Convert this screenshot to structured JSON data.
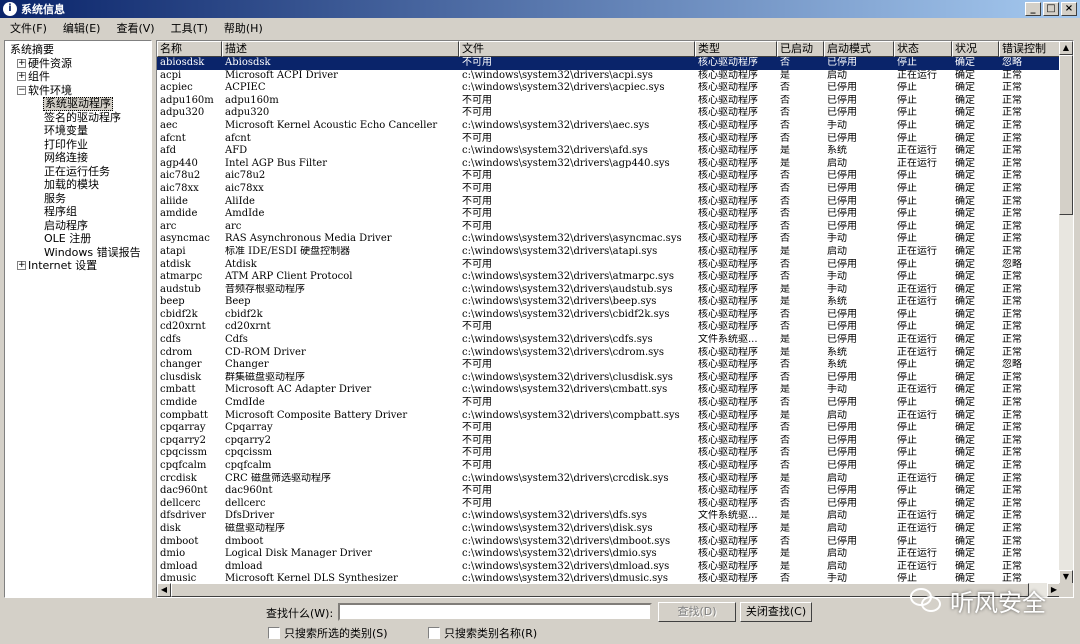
{
  "window": {
    "title": "系统信息",
    "controls": [
      "_",
      "□",
      "×"
    ]
  },
  "menu": [
    "文件(F)",
    "编辑(E)",
    "查看(V)",
    "工具(T)",
    "帮助(H)"
  ],
  "tree": [
    {
      "label": "系统摘要",
      "level": 0,
      "expander": ""
    },
    {
      "label": "硬件资源",
      "level": 1,
      "expander": "+"
    },
    {
      "label": "组件",
      "level": 1,
      "expander": "+"
    },
    {
      "label": "软件环境",
      "level": 1,
      "expander": "−"
    },
    {
      "label": "系统驱动程序",
      "level": 2,
      "expander": "",
      "selected": true
    },
    {
      "label": "签名的驱动程序",
      "level": 2,
      "expander": ""
    },
    {
      "label": "环境变量",
      "level": 2,
      "expander": ""
    },
    {
      "label": "打印作业",
      "level": 2,
      "expander": ""
    },
    {
      "label": "网络连接",
      "level": 2,
      "expander": ""
    },
    {
      "label": "正在运行任务",
      "level": 2,
      "expander": ""
    },
    {
      "label": "加载的模块",
      "level": 2,
      "expander": ""
    },
    {
      "label": "服务",
      "level": 2,
      "expander": ""
    },
    {
      "label": "程序组",
      "level": 2,
      "expander": ""
    },
    {
      "label": "启动程序",
      "level": 2,
      "expander": ""
    },
    {
      "label": "OLE 注册",
      "level": 2,
      "expander": ""
    },
    {
      "label": "Windows 错误报告",
      "level": 2,
      "expander": ""
    },
    {
      "label": "Internet 设置",
      "level": 1,
      "expander": "+"
    }
  ],
  "table": {
    "columns": [
      "名称",
      "描述",
      "文件",
      "类型",
      "已启动",
      "启动模式",
      "状态",
      "状况",
      "错误控制"
    ],
    "rows": [
      [
        "abiosdsk",
        "Abiosdsk",
        "不可用",
        "核心驱动程序",
        "否",
        "已停用",
        "停止",
        "确定",
        "忽略"
      ],
      [
        "acpi",
        "Microsoft ACPI Driver",
        "c:\\windows\\system32\\drivers\\acpi.sys",
        "核心驱动程序",
        "是",
        "启动",
        "正在运行",
        "确定",
        "正常"
      ],
      [
        "acpiec",
        "ACPIEC",
        "c:\\windows\\system32\\drivers\\acpiec.sys",
        "核心驱动程序",
        "否",
        "已停用",
        "停止",
        "确定",
        "正常"
      ],
      [
        "adpu160m",
        "adpu160m",
        "不可用",
        "核心驱动程序",
        "否",
        "已停用",
        "停止",
        "确定",
        "正常"
      ],
      [
        "adpu320",
        "adpu320",
        "不可用",
        "核心驱动程序",
        "否",
        "已停用",
        "停止",
        "确定",
        "正常"
      ],
      [
        "aec",
        "Microsoft Kernel Acoustic Echo Canceller",
        "c:\\windows\\system32\\drivers\\aec.sys",
        "核心驱动程序",
        "否",
        "手动",
        "停止",
        "确定",
        "正常"
      ],
      [
        "afcnt",
        "afcnt",
        "不可用",
        "核心驱动程序",
        "否",
        "已停用",
        "停止",
        "确定",
        "正常"
      ],
      [
        "afd",
        "AFD",
        "c:\\windows\\system32\\drivers\\afd.sys",
        "核心驱动程序",
        "是",
        "系统",
        "正在运行",
        "确定",
        "正常"
      ],
      [
        "agp440",
        "Intel AGP Bus Filter",
        "c:\\windows\\system32\\drivers\\agp440.sys",
        "核心驱动程序",
        "是",
        "启动",
        "正在运行",
        "确定",
        "正常"
      ],
      [
        "aic78u2",
        "aic78u2",
        "不可用",
        "核心驱动程序",
        "否",
        "已停用",
        "停止",
        "确定",
        "正常"
      ],
      [
        "aic78xx",
        "aic78xx",
        "不可用",
        "核心驱动程序",
        "否",
        "已停用",
        "停止",
        "确定",
        "正常"
      ],
      [
        "aliide",
        "AliIde",
        "不可用",
        "核心驱动程序",
        "否",
        "已停用",
        "停止",
        "确定",
        "正常"
      ],
      [
        "amdide",
        "AmdIde",
        "不可用",
        "核心驱动程序",
        "否",
        "已停用",
        "停止",
        "确定",
        "正常"
      ],
      [
        "arc",
        "arc",
        "不可用",
        "核心驱动程序",
        "否",
        "已停用",
        "停止",
        "确定",
        "正常"
      ],
      [
        "asyncmac",
        "RAS Asynchronous Media Driver",
        "c:\\windows\\system32\\drivers\\asyncmac.sys",
        "核心驱动程序",
        "否",
        "手动",
        "停止",
        "确定",
        "正常"
      ],
      [
        "atapi",
        "标准 IDE/ESDI 硬盘控制器",
        "c:\\windows\\system32\\drivers\\atapi.sys",
        "核心驱动程序",
        "是",
        "启动",
        "正在运行",
        "确定",
        "正常"
      ],
      [
        "atdisk",
        "Atdisk",
        "不可用",
        "核心驱动程序",
        "否",
        "已停用",
        "停止",
        "确定",
        "忽略"
      ],
      [
        "atmarpc",
        "ATM ARP Client Protocol",
        "c:\\windows\\system32\\drivers\\atmarpc.sys",
        "核心驱动程序",
        "否",
        "手动",
        "停止",
        "确定",
        "正常"
      ],
      [
        "audstub",
        "音频存根驱动程序",
        "c:\\windows\\system32\\drivers\\audstub.sys",
        "核心驱动程序",
        "是",
        "手动",
        "正在运行",
        "确定",
        "正常"
      ],
      [
        "beep",
        "Beep",
        "c:\\windows\\system32\\drivers\\beep.sys",
        "核心驱动程序",
        "是",
        "系统",
        "正在运行",
        "确定",
        "正常"
      ],
      [
        "cbidf2k",
        "cbidf2k",
        "c:\\windows\\system32\\drivers\\cbidf2k.sys",
        "核心驱动程序",
        "否",
        "已停用",
        "停止",
        "确定",
        "正常"
      ],
      [
        "cd20xrnt",
        "cd20xrnt",
        "不可用",
        "核心驱动程序",
        "否",
        "已停用",
        "停止",
        "确定",
        "正常"
      ],
      [
        "cdfs",
        "Cdfs",
        "c:\\windows\\system32\\drivers\\cdfs.sys",
        "文件系统驱...",
        "是",
        "已停用",
        "正在运行",
        "确定",
        "正常"
      ],
      [
        "cdrom",
        "CD-ROM Driver",
        "c:\\windows\\system32\\drivers\\cdrom.sys",
        "核心驱动程序",
        "是",
        "系统",
        "正在运行",
        "确定",
        "正常"
      ],
      [
        "changer",
        "Changer",
        "不可用",
        "核心驱动程序",
        "否",
        "系统",
        "停止",
        "确定",
        "忽略"
      ],
      [
        "clusdisk",
        "群集磁盘驱动程序",
        "c:\\windows\\system32\\drivers\\clusdisk.sys",
        "核心驱动程序",
        "否",
        "已停用",
        "停止",
        "确定",
        "正常"
      ],
      [
        "cmbatt",
        "Microsoft AC Adapter Driver",
        "c:\\windows\\system32\\drivers\\cmbatt.sys",
        "核心驱动程序",
        "是",
        "手动",
        "正在运行",
        "确定",
        "正常"
      ],
      [
        "cmdide",
        "CmdIde",
        "不可用",
        "核心驱动程序",
        "否",
        "已停用",
        "停止",
        "确定",
        "正常"
      ],
      [
        "compbatt",
        "Microsoft Composite Battery Driver",
        "c:\\windows\\system32\\drivers\\compbatt.sys",
        "核心驱动程序",
        "是",
        "启动",
        "正在运行",
        "确定",
        "正常"
      ],
      [
        "cpqarray",
        "Cpqarray",
        "不可用",
        "核心驱动程序",
        "否",
        "已停用",
        "停止",
        "确定",
        "正常"
      ],
      [
        "cpqarry2",
        "cpqarry2",
        "不可用",
        "核心驱动程序",
        "否",
        "已停用",
        "停止",
        "确定",
        "正常"
      ],
      [
        "cpqcissm",
        "cpqcissm",
        "不可用",
        "核心驱动程序",
        "否",
        "已停用",
        "停止",
        "确定",
        "正常"
      ],
      [
        "cpqfcalm",
        "cpqfcalm",
        "不可用",
        "核心驱动程序",
        "否",
        "已停用",
        "停止",
        "确定",
        "正常"
      ],
      [
        "crcdisk",
        "CRC 磁盘筛选驱动程序",
        "c:\\windows\\system32\\drivers\\crcdisk.sys",
        "核心驱动程序",
        "是",
        "启动",
        "正在运行",
        "确定",
        "正常"
      ],
      [
        "dac960nt",
        "dac960nt",
        "不可用",
        "核心驱动程序",
        "否",
        "已停用",
        "停止",
        "确定",
        "正常"
      ],
      [
        "dellcerc",
        "dellcerc",
        "不可用",
        "核心驱动程序",
        "否",
        "已停用",
        "停止",
        "确定",
        "正常"
      ],
      [
        "dfsdriver",
        "DfsDriver",
        "c:\\windows\\system32\\drivers\\dfs.sys",
        "文件系统驱...",
        "是",
        "启动",
        "正在运行",
        "确定",
        "正常"
      ],
      [
        "disk",
        "磁盘驱动程序",
        "c:\\windows\\system32\\drivers\\disk.sys",
        "核心驱动程序",
        "是",
        "启动",
        "正在运行",
        "确定",
        "正常"
      ],
      [
        "dmboot",
        "dmboot",
        "c:\\windows\\system32\\drivers\\dmboot.sys",
        "核心驱动程序",
        "否",
        "已停用",
        "停止",
        "确定",
        "正常"
      ],
      [
        "dmio",
        "Logical Disk Manager Driver",
        "c:\\windows\\system32\\drivers\\dmio.sys",
        "核心驱动程序",
        "是",
        "启动",
        "正在运行",
        "确定",
        "正常"
      ],
      [
        "dmload",
        "dmload",
        "c:\\windows\\system32\\drivers\\dmload.sys",
        "核心驱动程序",
        "是",
        "启动",
        "正在运行",
        "确定",
        "正常"
      ],
      [
        "dmusic",
        "Microsoft Kernel DLS Synthesizer",
        "c:\\windows\\system32\\drivers\\dmusic.sys",
        "核心驱动程序",
        "否",
        "手动",
        "停止",
        "确定",
        "正常"
      ]
    ]
  },
  "find": {
    "label": "查找什么(W):",
    "value": "",
    "find_button": "查找(D)",
    "close_button": "关闭查找(C)",
    "check_selected_category": "只搜索所选的类别(S)",
    "check_category_names": "只搜索类别名称(R)"
  },
  "watermark": "听风安全",
  "colors": {
    "selection": "#0a246a",
    "window_bg": "#d4d0c8"
  }
}
